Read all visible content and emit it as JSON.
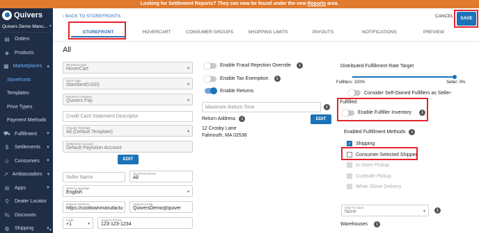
{
  "banner": {
    "text_before": "Looking for Settlement Reports? They can now be found under the new ",
    "link": "Reports",
    "text_after": " area."
  },
  "sidebar": {
    "logo": "Quivers",
    "store": "Quivers Demo Manu...",
    "items": [
      {
        "label": "Orders",
        "icon": "orders-icon"
      },
      {
        "label": "Products",
        "icon": "tag-icon"
      },
      {
        "label": "Marketplaces",
        "icon": "storefront-icon"
      },
      {
        "label": "Storefronts"
      },
      {
        "label": "Templates"
      },
      {
        "label": "Price Types"
      },
      {
        "label": "Payment Methods"
      },
      {
        "label": "Fulfillment",
        "icon": "truck-icon"
      },
      {
        "label": "Settlements",
        "icon": "dollar-icon"
      },
      {
        "label": "Consumers",
        "icon": "users-icon"
      },
      {
        "label": "Ambassadors",
        "icon": "chart-icon"
      },
      {
        "label": "Apps",
        "icon": "apps-icon"
      },
      {
        "label": "Dealer Locator",
        "icon": "pin-icon"
      },
      {
        "label": "Discounts",
        "icon": "percent-icon"
      },
      {
        "label": "Shipping",
        "icon": "globe-icon"
      }
    ]
  },
  "topbar": {
    "back": "BACK TO STOREFRONTS",
    "tabs": [
      "STOREFRONT",
      "HOVERCART",
      "CONSUMER GROUPS",
      "SHOPPING LIMITS",
      "PAYOUTS",
      "NOTIFICATIONS",
      "PREVIEW"
    ],
    "cancel": "CANCEL",
    "save": "SAVE"
  },
  "main": {
    "title": "All",
    "left": {
      "storefront_type": {
        "label": "Storefront type",
        "value": "HoverCart"
      },
      "price_type": {
        "label": "Price Type",
        "value": "Standard(USD)"
      },
      "payment_gateway": {
        "label": "Payment Gateway",
        "value": "Quivers Pay"
      },
      "descriptor": {
        "placeholder": "Credit Card Statement Descriptor"
      },
      "template": {
        "label": "Choose Template",
        "value": "All (Default Template)"
      },
      "settlement": {
        "label": "Settlement Account",
        "value": "Default Paylution Account"
      },
      "edit": "EDIT",
      "seller_name": {
        "placeholder": "Seller Name"
      },
      "storefront_name": {
        "label": "Storefront Name",
        "value": "All"
      },
      "language": {
        "label": "Select Language",
        "value": "English"
      },
      "website": {
        "label": "Support Website",
        "value": "https://cooltownmanufactu"
      },
      "email": {
        "label": "Support Email",
        "value": "QuiversDemo@quiver"
      },
      "code": {
        "label": "Code",
        "value": "+1"
      },
      "phone": {
        "label": "Support Phone",
        "value": "123-123-1234"
      }
    },
    "middle": {
      "fraud": "Enable Fraud Rejection Override",
      "tax": "Enable Tax Exemption",
      "returns": "Enable Returns",
      "max_return": {
        "placeholder": "Maximum Return Time"
      },
      "return_address_label": "Return Address",
      "address_line1": "12 Crosby Lane",
      "address_line2": "Falmouth, MA 02536",
      "edit": "EDIT",
      "toggles": {
        "fraud": false,
        "tax": false,
        "returns": true
      }
    },
    "right": {
      "distributed_title": "Distributed Fulfillment Rate Target",
      "fulfillers_label": "Fulfillers: 100%",
      "seller_label": "Seller: 0%",
      "slider_fulfillers_fraction": 1.0,
      "consider_line1": "Consider Self-Owned Fulfillers as Seller-",
      "consider_line2": "Fulfilled",
      "enable_inventory": "Enable Fulfiller Inventory",
      "methods_title": "Enabled Fulfillment Methods",
      "methods": [
        {
          "label": "Shipping",
          "state": "checked"
        },
        {
          "label": "Consumer-Selected Shipper",
          "state": "unchecked"
        },
        {
          "label": "In-Store Pickup",
          "state": "disabled"
        },
        {
          "label": "Curbside Pickup",
          "state": "disabled"
        },
        {
          "label": "White Glove Delivery",
          "state": "disabled"
        }
      ],
      "ship_to_store": {
        "label": "Ship-To-Store",
        "value": "None"
      },
      "warehouses": "Warehouses"
    }
  },
  "colors": {
    "accent": "#1a73b8",
    "banner": "#e07a2f",
    "sidebar": "#1f2d45",
    "highlight": "#e4232b"
  }
}
